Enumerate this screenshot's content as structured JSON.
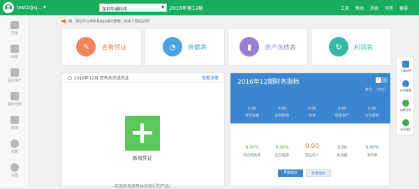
{
  "topbar": {
    "username": "test1@q...",
    "company": "深圳华通科技",
    "period": "2016年第12期",
    "nav": [
      "工具",
      "帮助",
      "消息",
      "问答",
      "客服"
    ]
  },
  "sidebar": {
    "items": [
      {
        "label": "凭证",
        "icon": "voucher-icon"
      },
      {
        "label": "出纳",
        "icon": "cashier-icon"
      },
      {
        "label": "固定资产",
        "icon": "fixed-assets-icon"
      },
      {
        "label": "期末结转",
        "icon": "period-end-icon"
      },
      {
        "label": "账簿",
        "icon": "ledger-icon"
      },
      {
        "label": "报表",
        "icon": "report-icon"
      },
      {
        "label": "设置",
        "icon": "settings-icon"
      }
    ]
  },
  "notice": "嗨，现在可以用手机App来记账啦，快来下载试试吧！",
  "quick": [
    {
      "label": "查看凭证",
      "icon": "voucher-search-icon",
      "color": "#f0855b"
    },
    {
      "label": "余额表",
      "icon": "pie-chart-icon",
      "color": "#4aa3df"
    },
    {
      "label": "资产负债表",
      "icon": "bar-chart-icon",
      "color": "#9b7fd1"
    },
    {
      "label": "利润表",
      "icon": "refresh-money-icon",
      "color": "#37b8a4"
    }
  ],
  "voucher": {
    "title": "2016年12月 您有未完成凭证",
    "detail": "查看详情",
    "new_label": "新增凭证",
    "welcome": "欢迎来到深思体验我们的产品！"
  },
  "finance": {
    "title": "2016年12期财务指标",
    "unit": "单位：（万元）",
    "metrics": [
      {
        "value": "0.00",
        "label": "货币资金"
      },
      {
        "value": "0.00",
        "label": "应收账款"
      },
      {
        "value": "0.00",
        "label": "存货"
      },
      {
        "value": "0.00",
        "label": "固定资产"
      },
      {
        "value": "0.00",
        "label": "应付账款"
      }
    ],
    "indicators": [
      {
        "value": "0.00%",
        "label": "综合税负率"
      },
      {
        "value": "0.00%",
        "label": "应交税费"
      },
      {
        "value": "0.00",
        "label": "营业收入"
      },
      {
        "value": "0.00",
        "label": "利润额"
      },
      {
        "value": "0.00%",
        "label": "净利率"
      }
    ],
    "tabs": [
      "月度指标",
      "年度指标"
    ]
  },
  "rightbar": [
    {
      "label": "下载APP",
      "icon": "phone-icon",
      "color": "#3b86cf"
    },
    {
      "label": "在线客服",
      "icon": "chat-icon",
      "color": "#3b86cf"
    },
    {
      "label": "加群交流",
      "icon": "group-icon",
      "color": "#4aa94a"
    },
    {
      "label": "关注我们",
      "icon": "wechat-icon",
      "color": "#4aa94a"
    }
  ],
  "colors": {
    "brand": "#1aac5e",
    "finance": "#3b86cf"
  }
}
